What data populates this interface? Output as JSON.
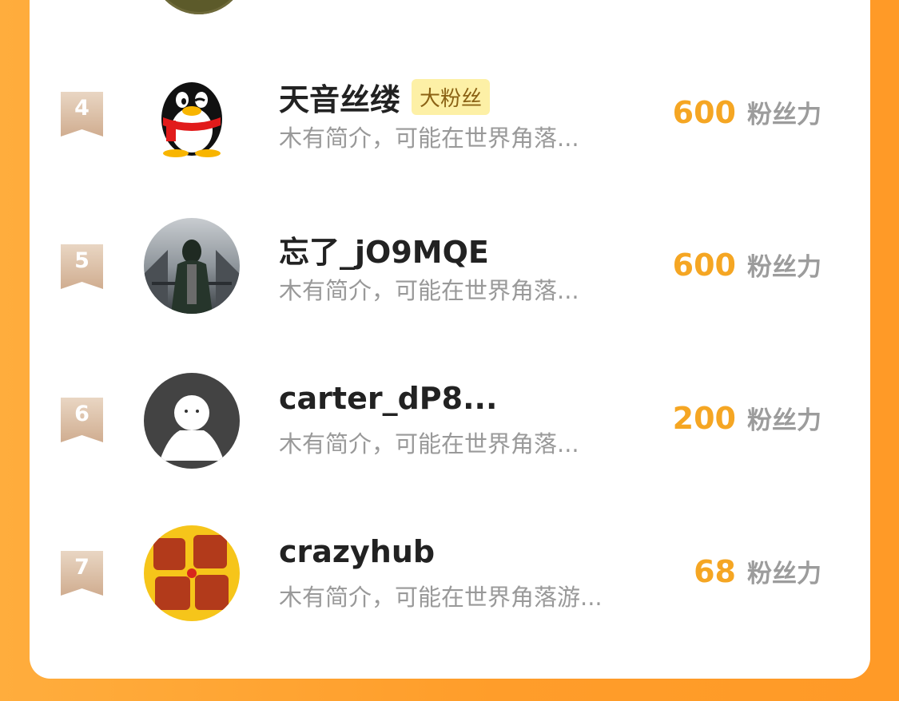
{
  "ranking": {
    "unit_label": "粉丝力",
    "items": [
      {
        "rank": "4",
        "name": "天音丝缕",
        "badge": "大粉丝",
        "bio": "木有简介，可能在世界角落...",
        "score": "600",
        "avatar": "qq-penguin-avatar"
      },
      {
        "rank": "5",
        "name": "忘了_jO9MQE",
        "badge": "",
        "bio": "木有简介，可能在世界角落...",
        "score": "600",
        "avatar": "snowy-photo-avatar"
      },
      {
        "rank": "6",
        "name": "carter_dP8...",
        "badge": "",
        "bio": "木有简介，可能在世界角落...",
        "score": "200",
        "avatar": "default-user-avatar"
      },
      {
        "rank": "7",
        "name": "crazyhub",
        "badge": "",
        "bio": "木有简介，可能在世界角落游...",
        "score": "68",
        "avatar": "thanks-text-avatar"
      }
    ]
  },
  "colors": {
    "background": "#ff9d2a",
    "score": "#f5a623",
    "badge_bg": "#fdf0a6",
    "rank_badge": "#d9bca3"
  }
}
